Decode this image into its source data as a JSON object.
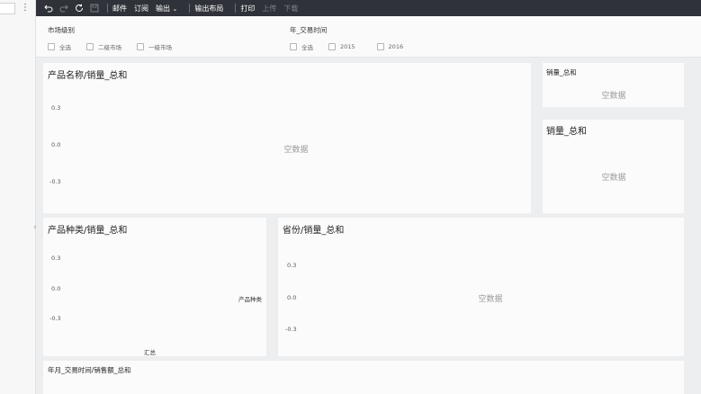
{
  "toolbar": {
    "buttons": [
      "邮件",
      "订阅",
      "输出",
      "输出布局",
      "打印",
      "上传",
      "下载"
    ]
  },
  "filters": {
    "market": {
      "title": "市场级别",
      "options": [
        "全选",
        "二级市场",
        "一级市场"
      ]
    },
    "year": {
      "title": "年_交易时间",
      "options": [
        "全选",
        "2015",
        "2016"
      ]
    }
  },
  "panels": {
    "product_name": {
      "title": "产品名称/销量_总和",
      "ticks": [
        "0.3",
        "0.0",
        "-0.3"
      ],
      "empty": "空数据"
    },
    "sales_small": {
      "title": "销量_总和",
      "empty": "空数据"
    },
    "sales_total": {
      "title": "销量_总和",
      "empty": "空数据"
    },
    "product_type": {
      "title": "产品种类/销量_总和",
      "ticks": [
        "0.3",
        "0.0",
        "-0.3"
      ],
      "x_label": "产品种类",
      "bottom_label": "汇总"
    },
    "province": {
      "title": "省份/销量_总和",
      "ticks": [
        "0.3",
        "0.0",
        "-0.3"
      ],
      "empty": "空数据"
    },
    "year_month": {
      "title": "年月_交易时间/销售额_总和"
    }
  }
}
